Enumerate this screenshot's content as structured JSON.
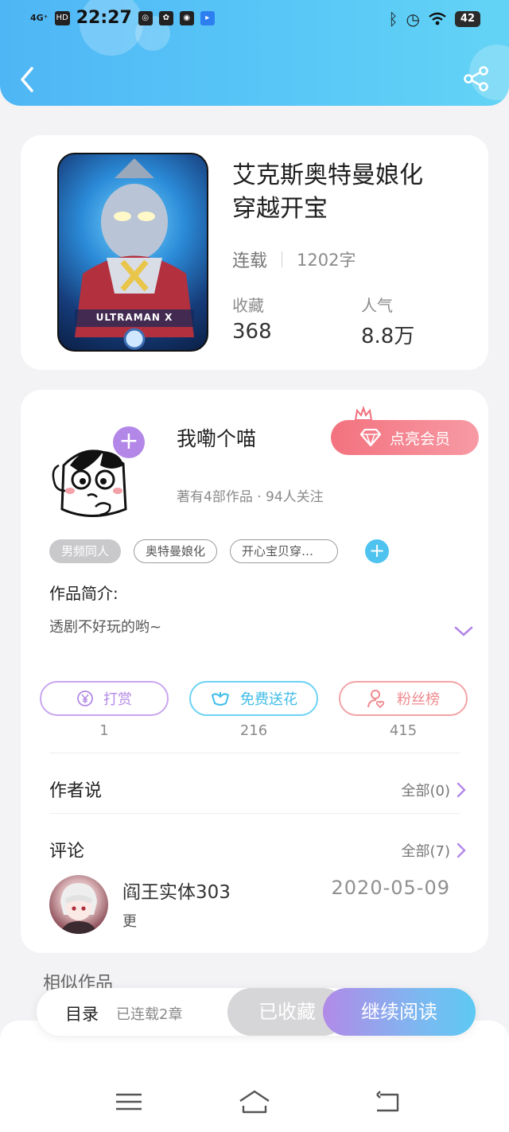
{
  "status_bar": {
    "signal": "4G⁺",
    "hd": "HD",
    "time": "22:27",
    "battery": "42"
  },
  "book": {
    "title_line1": "艾克斯奥特曼娘化",
    "title_line2": "穿越开宝",
    "status": "连载",
    "word_count": "1202字",
    "favorites_label": "收藏",
    "favorites_value": "368",
    "popularity_label": "人气",
    "popularity_value": "8.8万",
    "cover_text": "ULTRAMAN X"
  },
  "author": {
    "name": "我嘞个喵",
    "stats": "著有4部作品 · 94人关注",
    "vip_button": "点亮会员"
  },
  "tags": [
    "男频同人",
    "奥特曼娘化",
    "开心宝贝穿…"
  ],
  "intro": {
    "title": "作品简介:",
    "text": "透剧不好玩的哟~"
  },
  "actions": {
    "reward_label": "打赏",
    "reward_count": "1",
    "flower_label": "免费送花",
    "flower_count": "216",
    "fans_label": "粉丝榜",
    "fans_count": "415"
  },
  "author_says": {
    "title": "作者说",
    "more": "全部(0)"
  },
  "comments": {
    "title": "评论",
    "more": "全部(7)",
    "first": {
      "user": "阎王实体303",
      "date": "2020-05-09",
      "text": "更"
    }
  },
  "similar_title": "相似作品",
  "bottom_bar": {
    "toc_label": "目录",
    "toc_sub": "已连载2章",
    "collected_label": "已收藏",
    "continue_label": "继续阅读"
  },
  "colors": {
    "header": "#59c8f7",
    "purple_accent": "#b387e8",
    "cyan_accent": "#4fc3ef",
    "pink_accent": "#f3727f"
  }
}
